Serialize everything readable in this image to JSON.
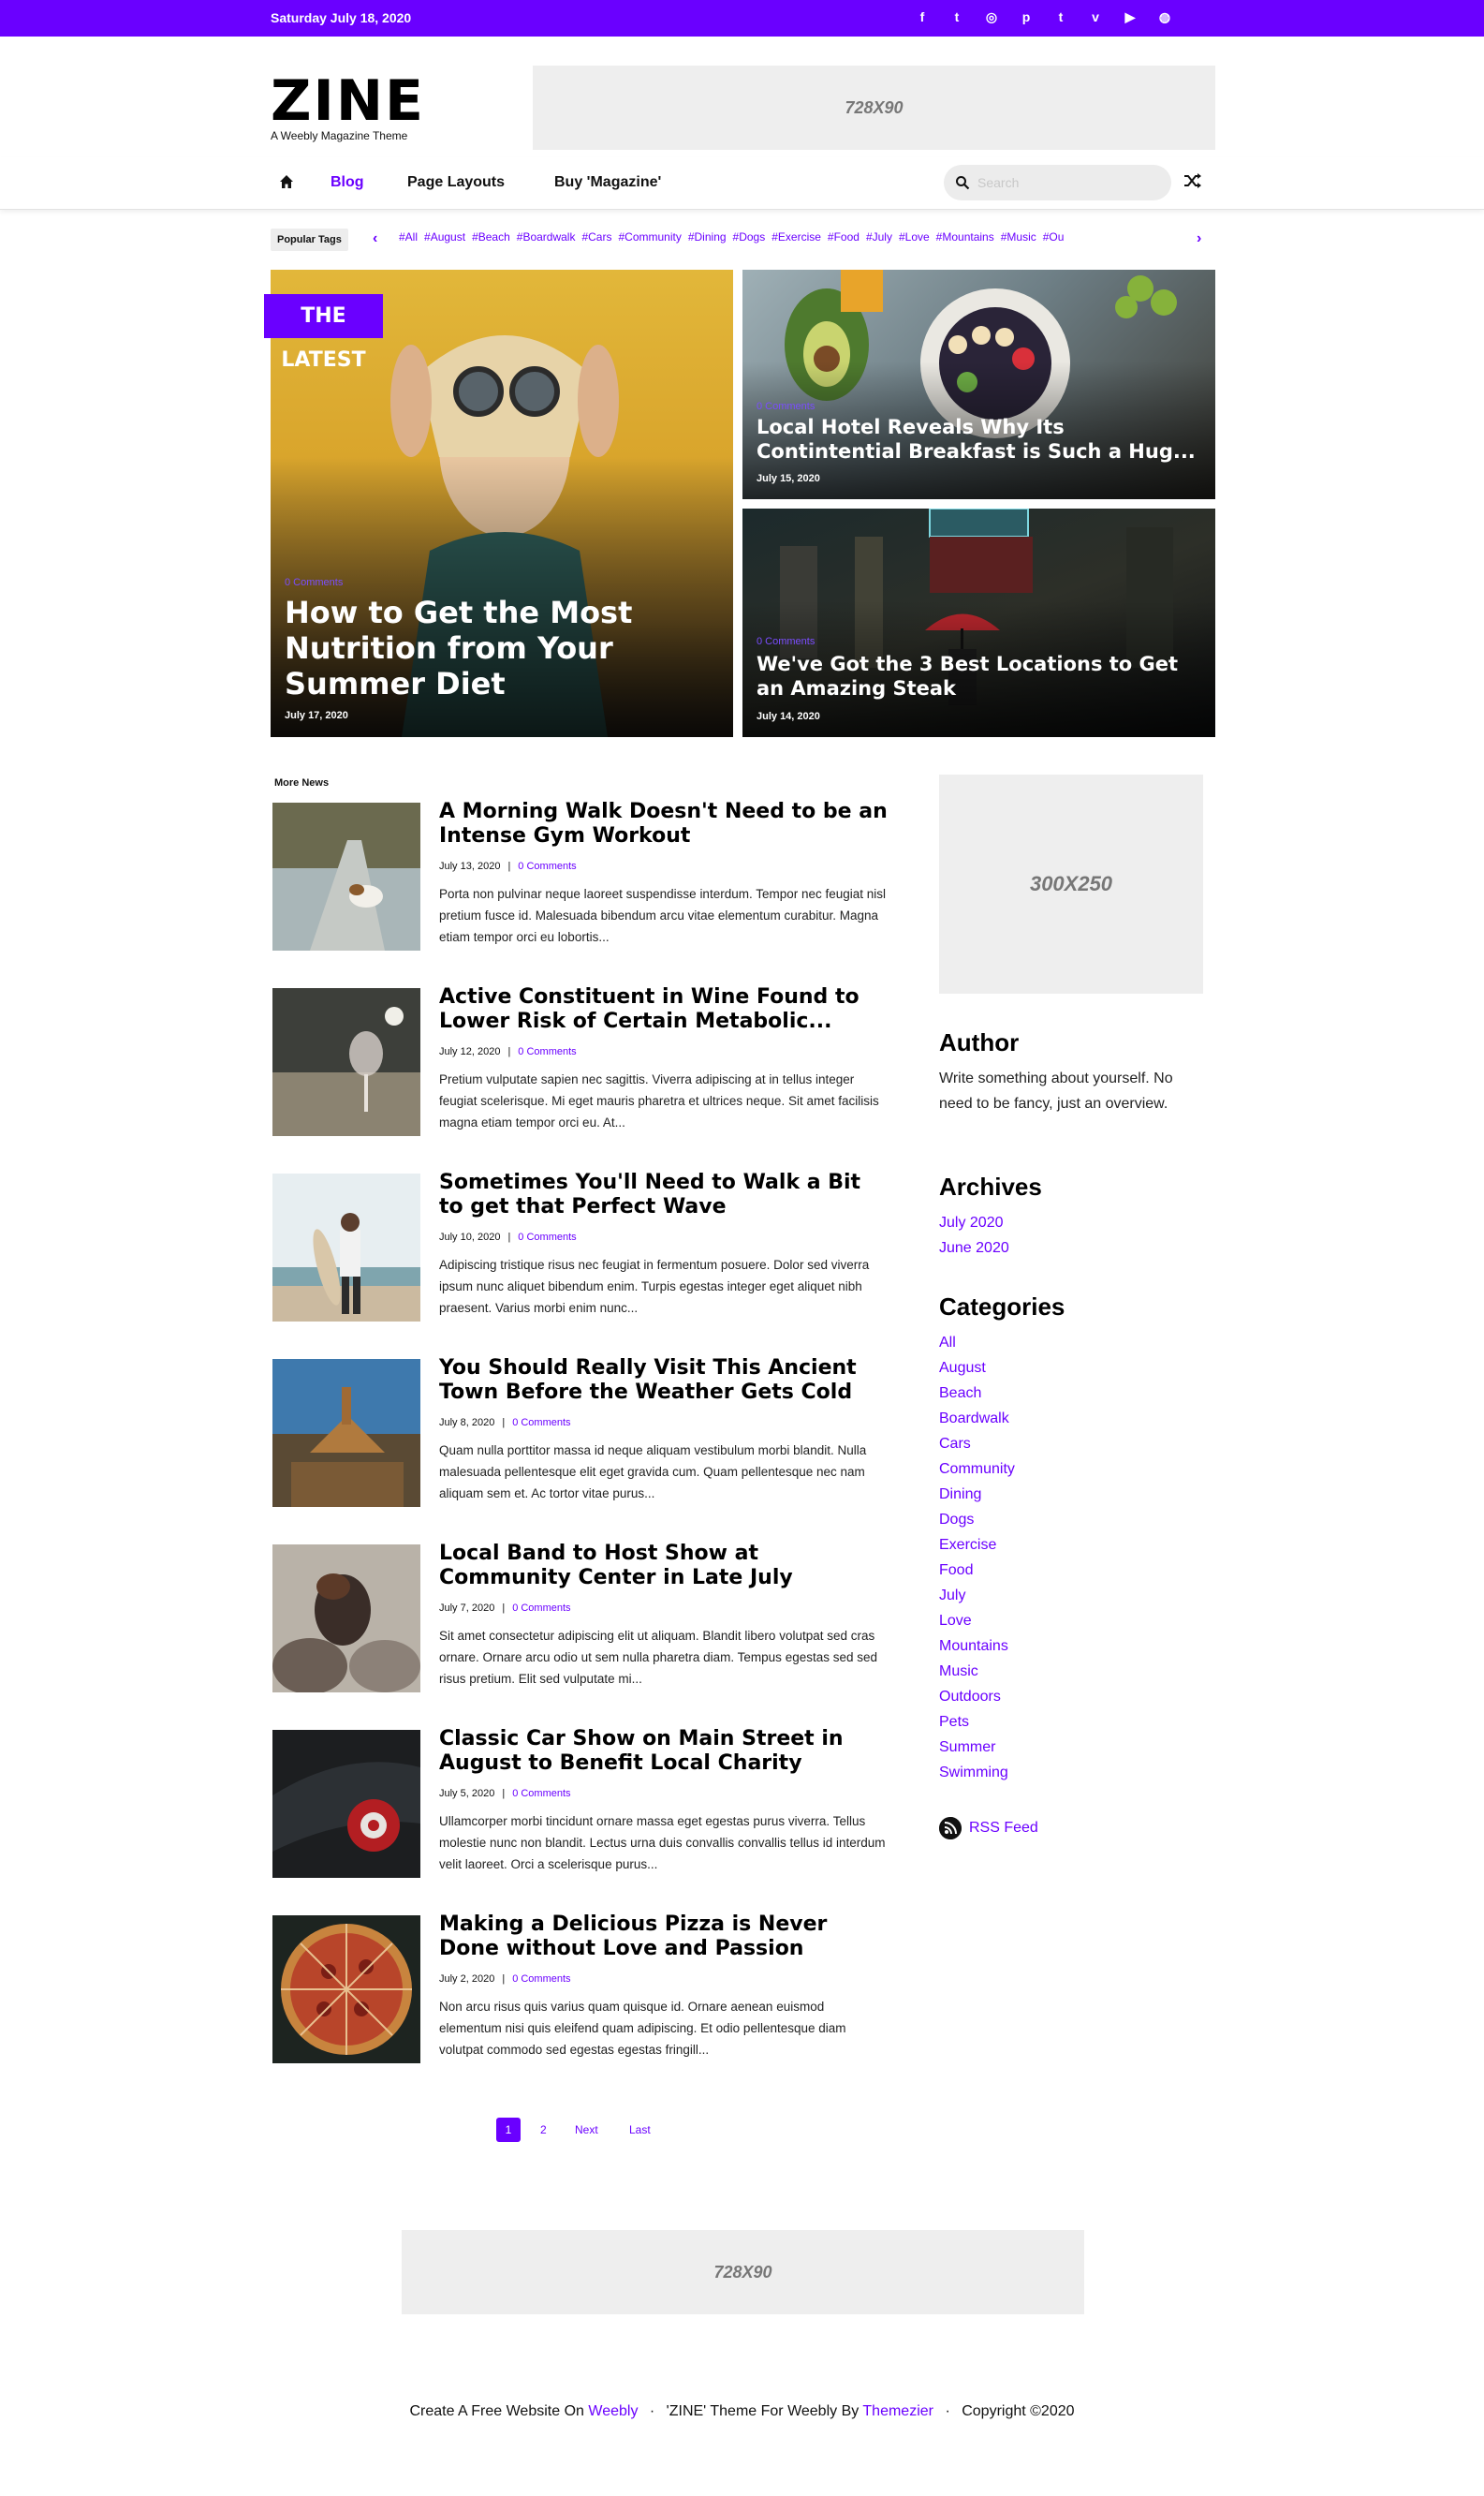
{
  "topbar": {
    "date": "Saturday July 18, 2020",
    "socials": [
      "facebook-icon",
      "twitter-icon",
      "instagram-icon",
      "pinterest-icon",
      "tumblr-icon",
      "vimeo-icon",
      "youtube-icon",
      "dribbble-icon"
    ],
    "social_glyphs": [
      "f",
      "t",
      "◎",
      "p",
      "t",
      "v",
      "▶",
      "◍"
    ]
  },
  "header": {
    "logo": "ZINE",
    "tagline": "A Weebly Magazine Theme",
    "ad_label": "728X90"
  },
  "nav": {
    "items": [
      "Blog",
      "Page Layouts",
      "Buy 'Magazine'"
    ],
    "search_placeholder": "Search"
  },
  "tags": {
    "label": "Popular Tags",
    "items": [
      "#All",
      "#August",
      "#Beach",
      "#Boardwalk",
      "#Cars",
      "#Community",
      "#Dining",
      "#Dogs",
      "#Exercise",
      "#Food",
      "#July",
      "#Love",
      "#Mountains",
      "#Music",
      "#Ou"
    ]
  },
  "hero": {
    "badge": "THE LATEST",
    "main": {
      "comments": "0 Comments",
      "title_lines": [
        "How to Get the Most",
        "Nutrition from Your",
        "Summer Diet"
      ],
      "date": "July 17, 2020"
    },
    "a": {
      "comments": "0 Comments",
      "title_lines": [
        "Local Hotel Reveals Why Its",
        "Contintential Breakfast is Such a Hug..."
      ],
      "date": "July 15, 2020"
    },
    "b": {
      "comments": "0 Comments",
      "title_lines": [
        "We've Got the 3 Best Locations to Get",
        "an Amazing Steak"
      ],
      "date": "July 14, 2020"
    }
  },
  "more_news": {
    "label": "More News",
    "posts": [
      {
        "title": "A Morning Walk Doesn't Need to be an Intense Gym Workout",
        "date": "July 13, 2020",
        "comments": "0 Comments",
        "excerpt": "Porta non pulvinar neque laoreet suspendisse interdum. Tempor nec feugiat nisl pretium fusce id. Malesuada bibendum arcu vitae elementum curabitur. Magna etiam tempor orci eu lobortis..."
      },
      {
        "title": "Active Constituent in Wine Found to Lower Risk of Certain Metabolic...",
        "date": "July 12, 2020",
        "comments": "0 Comments",
        "excerpt": "Pretium vulputate sapien nec sagittis. Viverra adipiscing at in tellus integer feugiat scelerisque. Mi eget mauris pharetra et ultrices neque. Sit amet facilisis magna etiam tempor orci eu. At..."
      },
      {
        "title": "Sometimes You'll Need to Walk a Bit to get that Perfect Wave",
        "date": "July 10, 2020",
        "comments": "0 Comments",
        "excerpt": "Adipiscing tristique risus nec feugiat in fermentum posuere. Dolor sed viverra ipsum nunc aliquet bibendum enim. Turpis egestas integer eget aliquet nibh praesent. Varius morbi enim nunc..."
      },
      {
        "title": "You Should Really Visit This Ancient Town Before the Weather Gets Cold",
        "date": "July 8, 2020",
        "comments": "0 Comments",
        "excerpt": "Quam nulla porttitor massa id neque aliquam vestibulum morbi blandit. Nulla malesuada pellentesque elit eget gravida cum. Quam pellentesque nec nam aliquam sem et. Ac tortor vitae purus..."
      },
      {
        "title": "Local Band to Host Show at Community Center in Late July",
        "date": "July 7, 2020",
        "comments": "0 Comments",
        "excerpt": "Sit amet consectetur adipiscing elit ut aliquam. Blandit libero volutpat sed cras ornare. Ornare arcu odio ut sem nulla pharetra diam. Tempus egestas sed sed risus pretium. Elit sed vulputate mi..."
      },
      {
        "title": "Classic Car Show on Main Street in August to Benefit Local Charity",
        "date": "July 5, 2020",
        "comments": "0 Comments",
        "excerpt": "Ullamcorper morbi tincidunt ornare massa eget egestas purus viverra. Tellus molestie nunc non blandit. Lectus urna duis convallis convallis tellus id interdum velit laoreet. Orci a scelerisque purus..."
      },
      {
        "title": "Making a Delicious Pizza is Never Done without Love and Passion",
        "date": "July 2, 2020",
        "comments": "0 Comments",
        "excerpt": "Non arcu risus quis varius quam quisque id. Ornare aenean euismod elementum nisi quis eleifend quam adipiscing. Et odio pellentesque diam volutpat commodo sed egestas egestas fringill..."
      }
    ]
  },
  "sidebar": {
    "ad_label": "300X250",
    "author_heading": "Author",
    "author_text": "Write something about yourself. No need to be fancy, just an overview.",
    "archives_heading": "Archives",
    "archives": [
      "July 2020",
      "June 2020"
    ],
    "categories_heading": "Categories",
    "categories": [
      "All",
      "August",
      "Beach",
      "Boardwalk",
      "Cars",
      "Community",
      "Dining",
      "Dogs",
      "Exercise",
      "Food",
      "July",
      "Love",
      "Mountains",
      "Music",
      "Outdoors",
      "Pets",
      "Summer",
      "Swimming"
    ],
    "rss": "RSS Feed"
  },
  "pagination": {
    "current": "1",
    "page2": "2",
    "next": "Next",
    "last": "Last"
  },
  "bottom_ad": "728X90",
  "footer": {
    "pre1": "Create A Free Website On",
    "link1": "Weebly",
    "pre2": "'ZINE' Theme For Weebly By",
    "link2": "Themezier",
    "copyright": "Copyright ©2020"
  },
  "colors": {
    "accent": "#6a00ff",
    "ad_bg": "#eeeeee"
  }
}
